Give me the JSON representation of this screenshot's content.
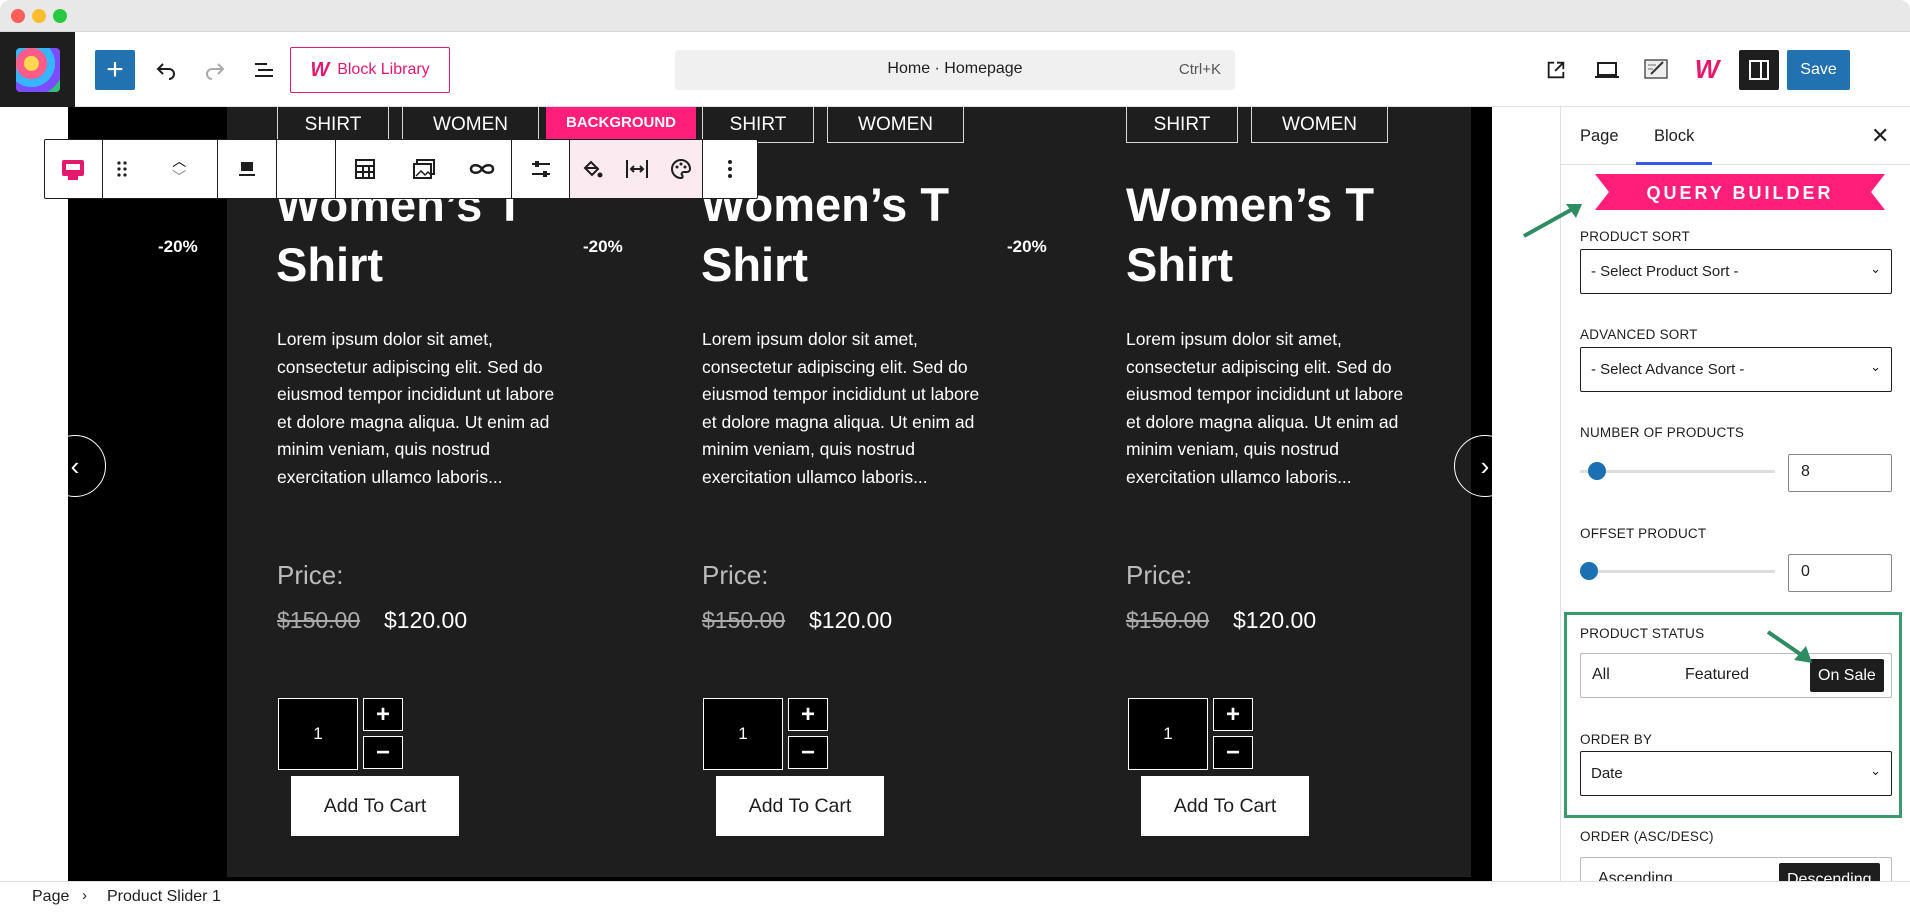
{
  "topbar": {
    "block_library": "Block Library",
    "command": "Home · Homepage",
    "shortcut": "Ctrl+K",
    "save": "Save"
  },
  "tabs": {
    "shirt": "SHIRT",
    "women": "WOMEN",
    "background": "BACKGROUND"
  },
  "products": [
    {
      "title_line1": "Women’s T",
      "title_line2": "Shirt",
      "discount": "-20%",
      "description": "Lorem ipsum dolor sit amet, consectetur adipiscing elit. Sed do eiusmod tempor incididunt ut labore et dolore magna aliqua. Ut enim ad minim veniam, quis nostrud exercitation ullamco laboris...",
      "price_label": "Price:",
      "old_price": "$150.00",
      "new_price": "$120.00",
      "quantity": "1",
      "cart": "Add To Cart"
    },
    {
      "title_line1": "Women’s T",
      "title_line2": "Shirt",
      "discount": "-20%",
      "description": "Lorem ipsum dolor sit amet, consectetur adipiscing elit. Sed do eiusmod tempor incididunt ut labore et dolore magna aliqua. Ut enim ad minim veniam, quis nostrud exercitation ullamco laboris...",
      "price_label": "Price:",
      "old_price": "$150.00",
      "new_price": "$120.00",
      "quantity": "1",
      "cart": "Add To Cart"
    },
    {
      "title_line1": "Women’s T",
      "title_line2": "Shirt",
      "discount": "-20%",
      "description": "Lorem ipsum dolor sit amet, consectetur adipiscing elit. Sed do eiusmod tempor incididunt ut labore et dolore magna aliqua. Ut enim ad minim veniam, quis nostrud exercitation ullamco laboris...",
      "price_label": "Price:",
      "old_price": "$150.00",
      "new_price": "$120.00",
      "quantity": "1",
      "cart": "Add To Cart"
    }
  ],
  "sidebar": {
    "tab_page": "Page",
    "tab_block": "Block",
    "banner": "QUERY BUILDER",
    "product_sort_label": "PRODUCT SORT",
    "product_sort_value": "- Select Product Sort -",
    "advanced_sort_label": "ADVANCED SORT",
    "advanced_sort_value": "- Select Advance Sort -",
    "num_products_label": "NUMBER OF PRODUCTS",
    "num_products_value": "8",
    "num_products_level": 0.08,
    "offset_label": "OFFSET PRODUCT",
    "offset_value": "0",
    "offset_level": 0,
    "status_label": "PRODUCT STATUS",
    "status_all": "All",
    "status_featured": "Featured",
    "status_onsale": "On Sale",
    "orderby_label": "ORDER BY",
    "orderby_value": "Date",
    "order_label": "ORDER (ASC/DESC)",
    "order_asc": "Ascending",
    "order_desc": "Descending"
  },
  "footer": {
    "crumb1": "Page",
    "crumb2": "Product Slider 1"
  },
  "colors": {
    "accent_blue": "#2271b1",
    "brand_pink": "#e4196e",
    "highlight_green": "#3a9a6e"
  }
}
